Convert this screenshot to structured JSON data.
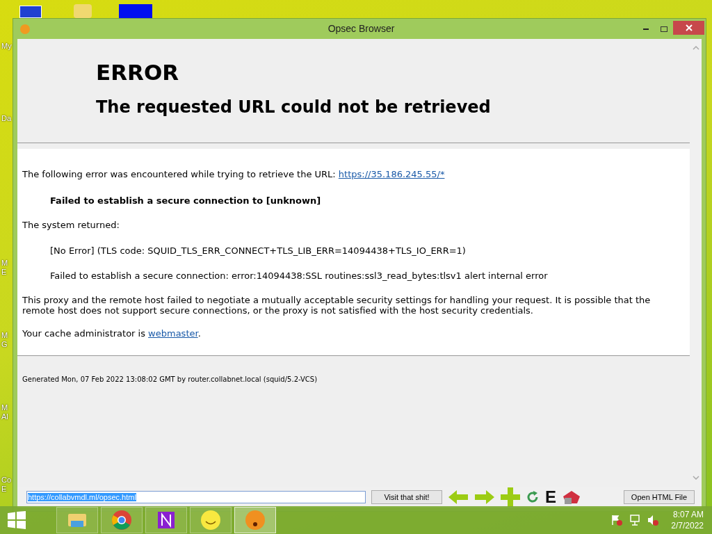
{
  "desktop": {
    "labels": [
      {
        "lines": [
          "My"
        ]
      },
      {
        "lines": [
          "Da"
        ]
      },
      {
        "lines": [
          "M",
          "E"
        ]
      },
      {
        "lines": [
          "M",
          "G"
        ]
      },
      {
        "lines": [
          "M",
          "Al"
        ]
      },
      {
        "lines": [
          "Co",
          "E"
        ]
      }
    ]
  },
  "window": {
    "title": "Opsec Browser"
  },
  "page": {
    "heading": "ERROR",
    "subheading": "The requested URL could not be retrieved",
    "intro": "The following error was encountered while trying to retrieve the URL: ",
    "url_link": "https://35.186.245.55/*",
    "error": "Failed to establish a secure connection to [unknown]",
    "returned_label": "The system returned:",
    "details": [
      "[No Error] (TLS code: SQUID_TLS_ERR_CONNECT+TLS_LIB_ERR=14094438+TLS_IO_ERR=1)",
      "Failed to establish a secure connection: error:14094438:SSL routines:ssl3_read_bytes:tlsv1 alert internal error"
    ],
    "explanation": "This proxy and the remote host failed to negotiate a mutually acceptable security settings for handling your request. It is possible that the remote host does not support secure connections, or the proxy is not satisfied with the host security credentials.",
    "admin_text": "Your cache administrator is ",
    "admin_link": "webmaster",
    "admin_end": ".",
    "footer": "Generated Mon, 07 Feb 2022 13:08:02 GMT by router.collabnet.local (squid/5.2-VCS)"
  },
  "toolbar": {
    "address": "https://collabvmdl.ml/opsec.html",
    "address_selected": true,
    "go_button": "Visit that shit!",
    "e_label": "E",
    "open_button": "Open HTML File"
  },
  "taskbar": {
    "apps": [
      {
        "kind": "folder",
        "selected": false
      },
      {
        "kind": "chrome",
        "selected": false
      },
      {
        "kind": "n-app",
        "selected": false
      },
      {
        "kind": "smiley",
        "selected": false
      },
      {
        "kind": "shocked",
        "selected": true
      }
    ],
    "time": "8:07 AM",
    "date": "2/7/2022"
  }
}
